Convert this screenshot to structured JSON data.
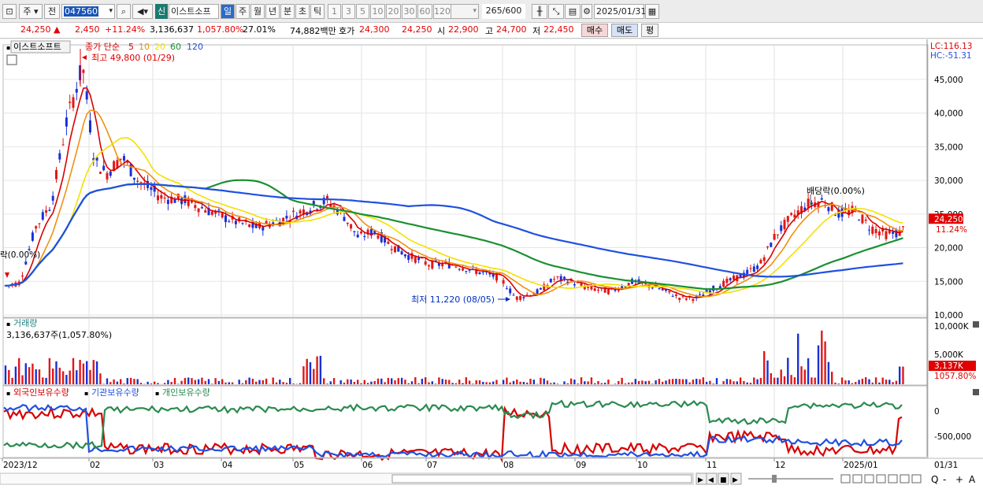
{
  "toolbar": {
    "market": "주",
    "prev": "전",
    "code": "047560",
    "new_badge": "신",
    "stock_name": "이스트소프",
    "periods": [
      "일",
      "주",
      "월",
      "년",
      "분",
      "초",
      "틱"
    ],
    "active_period": "일",
    "minutes": [
      "1",
      "3",
      "5",
      "10",
      "20",
      "30",
      "60",
      "120"
    ],
    "count": "265",
    "count_max": "/600",
    "date": "2025/01/31"
  },
  "info": {
    "price": "24,250",
    "change_arrow": "▲",
    "change": "2,450",
    "change_pct": "+11.24%",
    "volume": "3,136,637",
    "volume_pct": "1,057.80%",
    "turnover": "27.01%",
    "amount": "74,882백만",
    "bid_label": "호가",
    "ask": "24,300",
    "bid": "24,250",
    "open_label": "시",
    "open": "22,900",
    "high_label": "고",
    "high": "24,700",
    "low_label": "저",
    "low": "22,450",
    "buy": "매수",
    "sell": "매도",
    "eval": "평"
  },
  "price_panel": {
    "stock_label": "이스트소프트",
    "ma_prefix": "종가 단순",
    "ma_periods": [
      "5",
      "10",
      "20",
      "60",
      "120"
    ],
    "ma_colors": [
      "#d80000",
      "#f09010",
      "#f4e000",
      "#1a9030",
      "#2050e0"
    ],
    "lc": "LC:116.13",
    "hc": "HC:-51.31",
    "high_annotation": "최고 49,800 (01/29)",
    "low_annotation": "최저 11,220 (08/05)",
    "dividend_annotation": "배당락(0.00%)",
    "left_annotation": "락(0.00%)",
    "y_ticks": [
      "45,000",
      "40,000",
      "35,000",
      "30,000",
      "25,000",
      "20,000",
      "15,000",
      "10,000"
    ],
    "price_tag": "24,250",
    "pct_tag": "11.24%"
  },
  "volume_panel": {
    "title": "거래량",
    "value": "3,136,637주(1,057.80%)",
    "y_ticks": [
      "10,000K",
      "5,000K"
    ],
    "tag": "3,137K",
    "tag_pct": "1057.80%"
  },
  "holdings_panel": {
    "series": [
      "외국인보유수량",
      "기관보유수량",
      "개인보유수량"
    ],
    "colors": [
      "#d80000",
      "#2050e0",
      "#2a8a50"
    ],
    "y_ticks": [
      "0",
      "-500,000"
    ]
  },
  "x_axis": {
    "labels": [
      "2023/12",
      "02",
      "03",
      "04",
      "05",
      "06",
      "07",
      "08",
      "09",
      "10",
      "11",
      "12",
      "2025/01"
    ],
    "right_label": "01/31"
  },
  "bottom_icons": [
    "first-icon",
    "prev-icon",
    "stop-icon",
    "next-icon"
  ],
  "bottom_right": [
    "Q",
    "-",
    "+",
    "A"
  ],
  "chart_data": {
    "type": "candlestick",
    "price_range": [
      10000,
      48500
    ],
    "period": "2023/12 - 2025/01/31",
    "last_close": 24250,
    "high": 49800,
    "high_date": "01/29",
    "low": 11220,
    "low_date": "08/05"
  }
}
